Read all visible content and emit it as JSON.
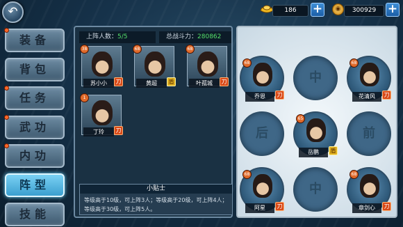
{
  "header": {
    "gold_value": "186",
    "coin_value": "300929",
    "back_icon": "back-arrow-icon",
    "gold_icon": "gold-ingot-icon",
    "coin_icon": "copper-coin-icon",
    "plus_label": "+",
    "coin_glyph": "◉",
    "back_glyph": "↶"
  },
  "menu": [
    {
      "label": "装备",
      "dot": true
    },
    {
      "label": "背包",
      "dot": false
    },
    {
      "label": "任务",
      "dot": true
    },
    {
      "label": "武功",
      "dot": true
    },
    {
      "label": "内功",
      "dot": true
    },
    {
      "label": "阵型",
      "dot": false,
      "active": true
    },
    {
      "label": "技能",
      "dot": false
    }
  ],
  "stats": {
    "deployed_label": "上阵人数：",
    "deployed_value": "5/5",
    "power_label": "总战斗力：",
    "power_value": "280862"
  },
  "roster": [
    {
      "name": "苏小小",
      "level": "38",
      "badge": "刀"
    },
    {
      "name": "黄超",
      "level": "68",
      "badge": "盾"
    },
    {
      "name": "叶孤城",
      "level": "68",
      "badge": "刀"
    },
    {
      "name": "丁玲",
      "level": "1",
      "badge": "刀"
    }
  ],
  "tip": {
    "title": "小贴士",
    "text": "等级高于10级，可上阵3人；等级高于20级，可上阵4人；等级高于30级，可上阵5人。"
  },
  "formation": {
    "front_label": "前",
    "middle_label": "中",
    "rear_label": "后",
    "heroes": [
      {
        "name": "乔恩",
        "level": "68",
        "badge": "刀"
      },
      {
        "name": "花清风",
        "level": "68",
        "badge": "刀"
      },
      {
        "name": "岳鹏",
        "level": "65",
        "badge": "盾"
      },
      {
        "name": "阿星",
        "level": "68",
        "badge": "刀"
      },
      {
        "name": "章剑心",
        "level": "68",
        "badge": "刀"
      }
    ]
  },
  "colors": {
    "accent": "#55e06a",
    "active_tab": "#3b9fcf"
  }
}
